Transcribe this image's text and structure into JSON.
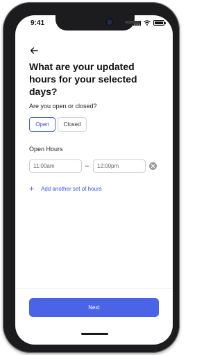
{
  "status_bar": {
    "time": "9:41",
    "colors": {
      "text": "#111111"
    }
  },
  "screen": {
    "title": "What are your updated hours for your selected days?",
    "open_closed_label": "Are you open or closed?",
    "options": [
      {
        "label": "Open",
        "selected": true
      },
      {
        "label": "Closed",
        "selected": false
      }
    ],
    "open_hours_label": "Open Hours",
    "hours": {
      "start_placeholder": "11:00am",
      "end_placeholder": "12:00pm"
    },
    "add_another_label": "Add another set of hours",
    "next_button_label": "Next"
  },
  "icons": [
    "back-arrow-icon",
    "clear-icon",
    "plus-icon",
    "signal-icon",
    "wifi-icon",
    "battery-icon"
  ],
  "colors": {
    "accent": "#4a63e7",
    "device": "#1c1c1e",
    "background": "#ffffff"
  }
}
